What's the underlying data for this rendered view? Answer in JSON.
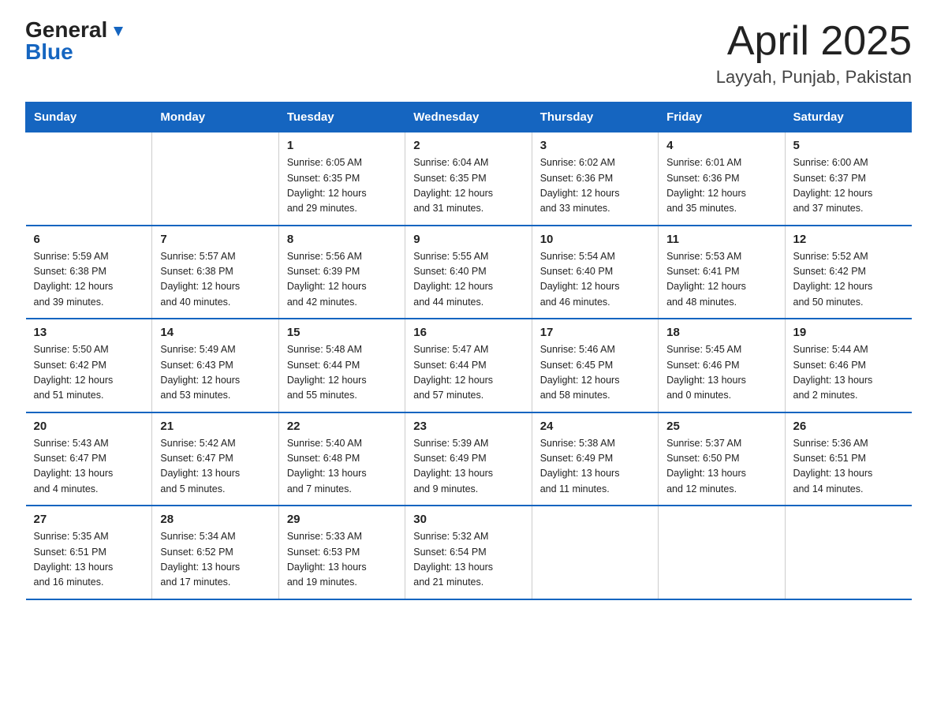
{
  "header": {
    "logo_general": "General",
    "logo_blue": "Blue",
    "title": "April 2025",
    "subtitle": "Layyah, Punjab, Pakistan"
  },
  "days_of_week": [
    "Sunday",
    "Monday",
    "Tuesday",
    "Wednesday",
    "Thursday",
    "Friday",
    "Saturday"
  ],
  "weeks": [
    [
      {
        "day": "",
        "info": ""
      },
      {
        "day": "",
        "info": ""
      },
      {
        "day": "1",
        "info": "Sunrise: 6:05 AM\nSunset: 6:35 PM\nDaylight: 12 hours\nand 29 minutes."
      },
      {
        "day": "2",
        "info": "Sunrise: 6:04 AM\nSunset: 6:35 PM\nDaylight: 12 hours\nand 31 minutes."
      },
      {
        "day": "3",
        "info": "Sunrise: 6:02 AM\nSunset: 6:36 PM\nDaylight: 12 hours\nand 33 minutes."
      },
      {
        "day": "4",
        "info": "Sunrise: 6:01 AM\nSunset: 6:36 PM\nDaylight: 12 hours\nand 35 minutes."
      },
      {
        "day": "5",
        "info": "Sunrise: 6:00 AM\nSunset: 6:37 PM\nDaylight: 12 hours\nand 37 minutes."
      }
    ],
    [
      {
        "day": "6",
        "info": "Sunrise: 5:59 AM\nSunset: 6:38 PM\nDaylight: 12 hours\nand 39 minutes."
      },
      {
        "day": "7",
        "info": "Sunrise: 5:57 AM\nSunset: 6:38 PM\nDaylight: 12 hours\nand 40 minutes."
      },
      {
        "day": "8",
        "info": "Sunrise: 5:56 AM\nSunset: 6:39 PM\nDaylight: 12 hours\nand 42 minutes."
      },
      {
        "day": "9",
        "info": "Sunrise: 5:55 AM\nSunset: 6:40 PM\nDaylight: 12 hours\nand 44 minutes."
      },
      {
        "day": "10",
        "info": "Sunrise: 5:54 AM\nSunset: 6:40 PM\nDaylight: 12 hours\nand 46 minutes."
      },
      {
        "day": "11",
        "info": "Sunrise: 5:53 AM\nSunset: 6:41 PM\nDaylight: 12 hours\nand 48 minutes."
      },
      {
        "day": "12",
        "info": "Sunrise: 5:52 AM\nSunset: 6:42 PM\nDaylight: 12 hours\nand 50 minutes."
      }
    ],
    [
      {
        "day": "13",
        "info": "Sunrise: 5:50 AM\nSunset: 6:42 PM\nDaylight: 12 hours\nand 51 minutes."
      },
      {
        "day": "14",
        "info": "Sunrise: 5:49 AM\nSunset: 6:43 PM\nDaylight: 12 hours\nand 53 minutes."
      },
      {
        "day": "15",
        "info": "Sunrise: 5:48 AM\nSunset: 6:44 PM\nDaylight: 12 hours\nand 55 minutes."
      },
      {
        "day": "16",
        "info": "Sunrise: 5:47 AM\nSunset: 6:44 PM\nDaylight: 12 hours\nand 57 minutes."
      },
      {
        "day": "17",
        "info": "Sunrise: 5:46 AM\nSunset: 6:45 PM\nDaylight: 12 hours\nand 58 minutes."
      },
      {
        "day": "18",
        "info": "Sunrise: 5:45 AM\nSunset: 6:46 PM\nDaylight: 13 hours\nand 0 minutes."
      },
      {
        "day": "19",
        "info": "Sunrise: 5:44 AM\nSunset: 6:46 PM\nDaylight: 13 hours\nand 2 minutes."
      }
    ],
    [
      {
        "day": "20",
        "info": "Sunrise: 5:43 AM\nSunset: 6:47 PM\nDaylight: 13 hours\nand 4 minutes."
      },
      {
        "day": "21",
        "info": "Sunrise: 5:42 AM\nSunset: 6:47 PM\nDaylight: 13 hours\nand 5 minutes."
      },
      {
        "day": "22",
        "info": "Sunrise: 5:40 AM\nSunset: 6:48 PM\nDaylight: 13 hours\nand 7 minutes."
      },
      {
        "day": "23",
        "info": "Sunrise: 5:39 AM\nSunset: 6:49 PM\nDaylight: 13 hours\nand 9 minutes."
      },
      {
        "day": "24",
        "info": "Sunrise: 5:38 AM\nSunset: 6:49 PM\nDaylight: 13 hours\nand 11 minutes."
      },
      {
        "day": "25",
        "info": "Sunrise: 5:37 AM\nSunset: 6:50 PM\nDaylight: 13 hours\nand 12 minutes."
      },
      {
        "day": "26",
        "info": "Sunrise: 5:36 AM\nSunset: 6:51 PM\nDaylight: 13 hours\nand 14 minutes."
      }
    ],
    [
      {
        "day": "27",
        "info": "Sunrise: 5:35 AM\nSunset: 6:51 PM\nDaylight: 13 hours\nand 16 minutes."
      },
      {
        "day": "28",
        "info": "Sunrise: 5:34 AM\nSunset: 6:52 PM\nDaylight: 13 hours\nand 17 minutes."
      },
      {
        "day": "29",
        "info": "Sunrise: 5:33 AM\nSunset: 6:53 PM\nDaylight: 13 hours\nand 19 minutes."
      },
      {
        "day": "30",
        "info": "Sunrise: 5:32 AM\nSunset: 6:54 PM\nDaylight: 13 hours\nand 21 minutes."
      },
      {
        "day": "",
        "info": ""
      },
      {
        "day": "",
        "info": ""
      },
      {
        "day": "",
        "info": ""
      }
    ]
  ]
}
